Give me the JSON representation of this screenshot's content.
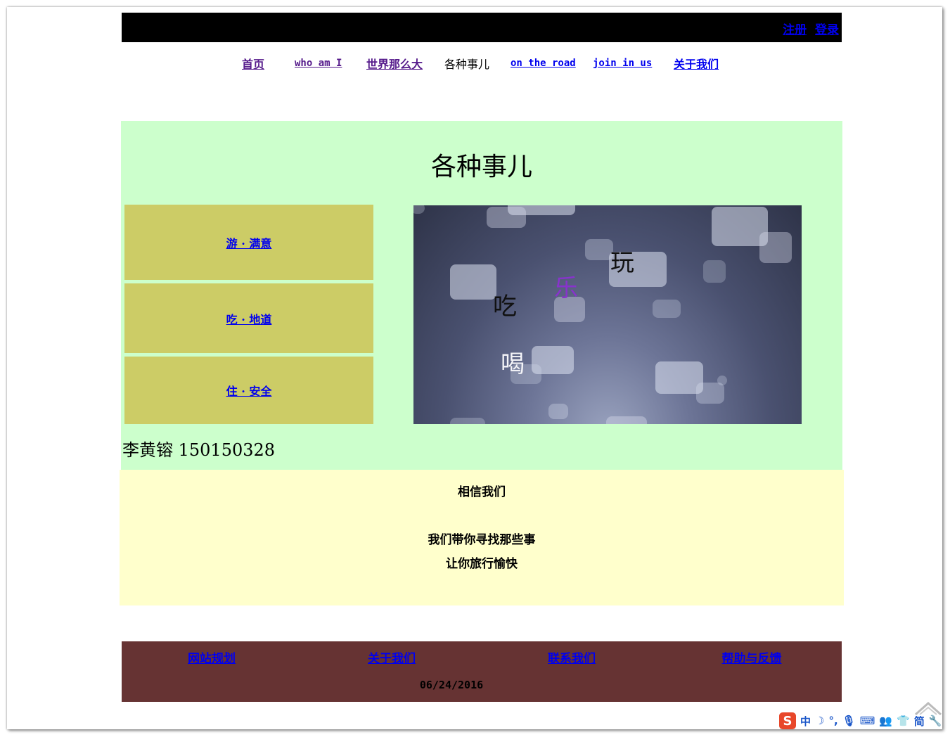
{
  "header": {
    "register": "注册",
    "login": "登录"
  },
  "nav": {
    "home": "首页",
    "who": "who am I",
    "world": "世界那么大",
    "things": "各种事儿",
    "road": "on the road",
    "join": "join in us",
    "about": "关于我们"
  },
  "main": {
    "title": "各种事儿",
    "boxes": [
      "游 · 满意",
      "吃 · 地道",
      "住 · 安全"
    ],
    "hero_words": {
      "play": "玩",
      "fun": "乐",
      "eat": "吃",
      "drink": "喝"
    },
    "contact": "李黄镕  150150328"
  },
  "slogan": {
    "line1": "相信我们",
    "line2": "我们带你寻找那些事",
    "line3": "让你旅行愉快"
  },
  "footer": {
    "links": [
      "网站规划",
      "关于我们",
      "联系我们",
      "帮助与反馈"
    ],
    "date": "06/24/2016"
  },
  "ime": {
    "logo": "S",
    "mode": "中",
    "simplified": "简"
  },
  "colors": {
    "main_bg": "#ccffcc",
    "box_bg": "#cccc66",
    "slogan_bg": "#ffffcc",
    "footer_bg": "#663333",
    "fun_word": "#8833cc"
  }
}
